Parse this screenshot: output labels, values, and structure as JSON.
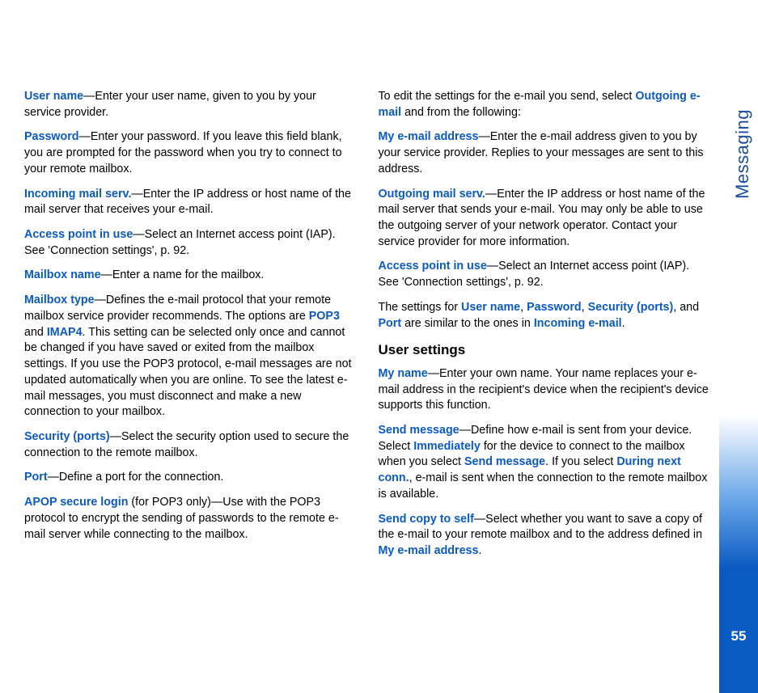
{
  "sidebar": {
    "label": "Messaging",
    "pageNumber": "55"
  },
  "left": {
    "userName": {
      "term": "User name",
      "text": "—Enter your user name, given to you by your service provider."
    },
    "password": {
      "term": "Password",
      "text": "—Enter your password. If you leave this field blank, you are prompted for the password when you try to connect to your remote mailbox."
    },
    "incoming": {
      "term": "Incoming mail serv.",
      "text": "—Enter the IP address or host name of the mail server that receives your e-mail."
    },
    "ap": {
      "term": "Access point in use",
      "text": "—Select an Internet access point (IAP). See 'Connection settings', p. 92."
    },
    "mboxName": {
      "term": "Mailbox name",
      "text": "—Enter a name for the mailbox."
    },
    "mboxType": {
      "term": "Mailbox type",
      "pre": "—Defines the e-mail protocol that your remote mailbox service provider recommends. The options are ",
      "pop3": "POP3",
      "and": " and ",
      "imap4": "IMAP4",
      "post": ". This setting can be selected only once and cannot be changed if you have saved or exited from the mailbox settings. If you use the POP3 protocol, e-mail messages are not updated automatically when you are online. To see the latest e-mail messages, you must disconnect and make a new connection to your mailbox."
    },
    "security": {
      "term": "Security (ports)",
      "text": "—Select the security option used to secure the connection to the remote mailbox."
    },
    "port": {
      "term": "Port",
      "text": "—Define a port for the connection."
    },
    "apop": {
      "term": "APOP secure login",
      "text": " (for POP3 only)—Use with the POP3 protocol to encrypt the sending of passwords to the remote e-mail server while connecting to the mailbox."
    }
  },
  "right": {
    "editIntro": {
      "pre": "To edit the settings for the e-mail you send, select ",
      "term": "Outgoing e-mail",
      "post": " and from the following:"
    },
    "myAddr": {
      "term": "My e-mail address",
      "text": "—Enter the e-mail address given to you by your service provider. Replies to your messages are sent to this address."
    },
    "outgoing": {
      "term": "Outgoing mail serv.",
      "text": "—Enter the IP address or host name of the mail server that sends your e-mail. You may only be able to use the outgoing server of your network operator. Contact your service provider for more information."
    },
    "ap": {
      "term": "Access point in use",
      "text": "—Select an Internet access point (IAP). See 'Connection settings', p. 92."
    },
    "similar": {
      "pre": "The settings for ",
      "t1": "User name",
      "c1": ", ",
      "t2": "Password",
      "c2": ", ",
      "t3": "Security (ports)",
      "c3": ", and ",
      "t4": "Port",
      "mid": " are similar to the ones in ",
      "t5": "Incoming e-mail",
      "post": "."
    },
    "userSettingsHeading": "User settings",
    "myName": {
      "term": "My name",
      "text": "—Enter your own name. Your name replaces your e-mail address in the recipient's device when the recipient's device supports this function."
    },
    "sendMsg": {
      "term": "Send message",
      "p1": "—Define how e-mail is sent from your device. Select ",
      "imm": "Immediately",
      "p2": " for the device to connect to the mailbox when you select ",
      "sm": "Send message",
      "p3": ". If you select ",
      "dnc": "During next conn.",
      "p4": ", e-mail is sent when the connection to the remote mailbox is available."
    },
    "sendCopy": {
      "term": "Send copy to self",
      "p1": "—Select whether you want to save a copy of the e-mail to your remote mailbox and to the address defined in ",
      "addr": "My e-mail address",
      "post": "."
    }
  }
}
